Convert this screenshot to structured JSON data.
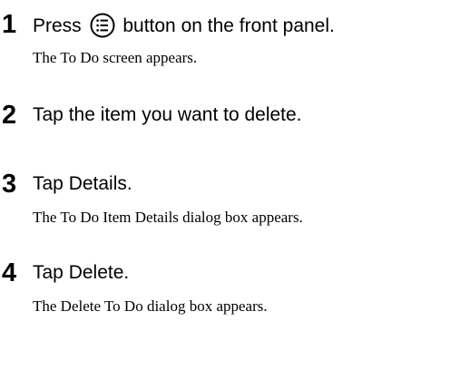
{
  "steps": [
    {
      "number": "1",
      "instruction_before": "Press",
      "icon": "todo-list-icon",
      "instruction_after": "button on the front panel.",
      "result": "The To Do screen appears."
    },
    {
      "number": "2",
      "instruction": "Tap the item you want to delete."
    },
    {
      "number": "3",
      "instruction": "Tap Details.",
      "result": "The To Do Item Details dialog box appears."
    },
    {
      "number": "4",
      "instruction": "Tap Delete.",
      "result": "The Delete To Do dialog box appears."
    }
  ]
}
